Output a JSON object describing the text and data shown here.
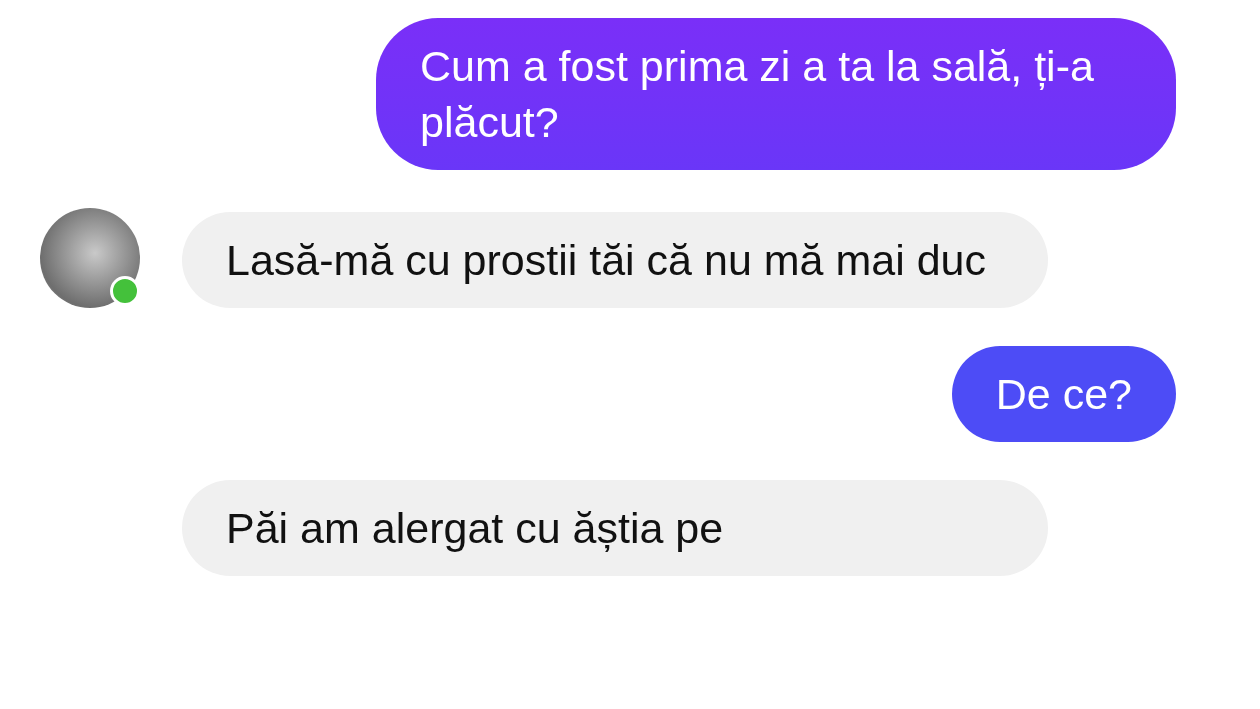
{
  "messages": [
    {
      "kind": "sent",
      "text": "Cum a fost prima zi a ta la sală, ți-a plăcut?"
    },
    {
      "kind": "received",
      "text": "Lasă-mă cu prostii tăi că nu mă mai duc",
      "avatar": {
        "online": true
      }
    },
    {
      "kind": "sent",
      "text": "De ce?"
    },
    {
      "kind": "received",
      "text": "Păi am alergat cu ăștia pe"
    }
  ]
}
